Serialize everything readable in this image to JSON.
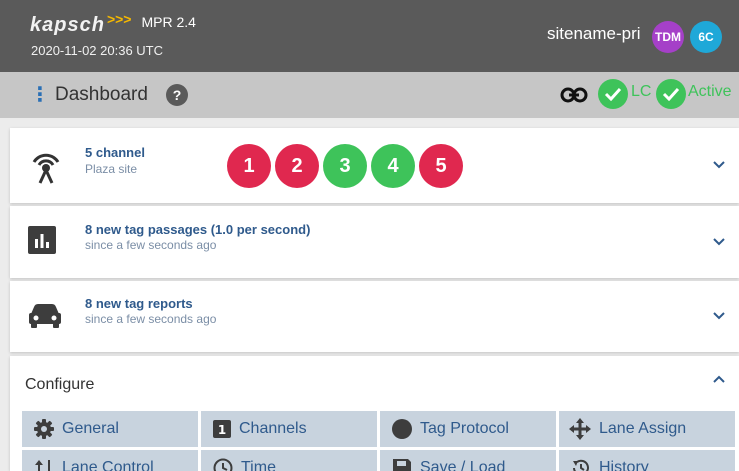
{
  "header": {
    "brand": "kapsch",
    "brand_chevrons": ">>>",
    "version": "MPR 2.4",
    "datetime": "2020-11-02 20:36  UTC",
    "sitename": "sitename-pri",
    "badge_tdm": "TDM",
    "badge_6c": "6C"
  },
  "subbar": {
    "title": "Dashboard",
    "help": "?",
    "status_lc": "LC",
    "status_active": "Active"
  },
  "cards": [
    {
      "title": "5 channel",
      "sub": "Plaza site"
    },
    {
      "title": "8 new tag passages (1.0 per second)",
      "sub": "since a few seconds ago"
    },
    {
      "title": "8 new tag reports",
      "sub": "since a few seconds ago"
    }
  ],
  "channels": [
    {
      "label": "1",
      "color": "#e0284f"
    },
    {
      "label": "2",
      "color": "#e0284f"
    },
    {
      "label": "3",
      "color": "#3ec35a"
    },
    {
      "label": "4",
      "color": "#3ec35a"
    },
    {
      "label": "5",
      "color": "#e0284f"
    }
  ],
  "configure": {
    "title": "Configure",
    "buttons": [
      "General",
      "Channels",
      "Tag Protocol",
      "Lane Assign",
      "Lane Control",
      "Time",
      "Save / Load",
      "History"
    ]
  },
  "colors": {
    "header_bg": "#5a5a5a",
    "ok_green": "#3ec35a",
    "alert_red": "#e0284f",
    "link_blue": "#2f5a8c",
    "button_bg": "#c8d3de"
  }
}
